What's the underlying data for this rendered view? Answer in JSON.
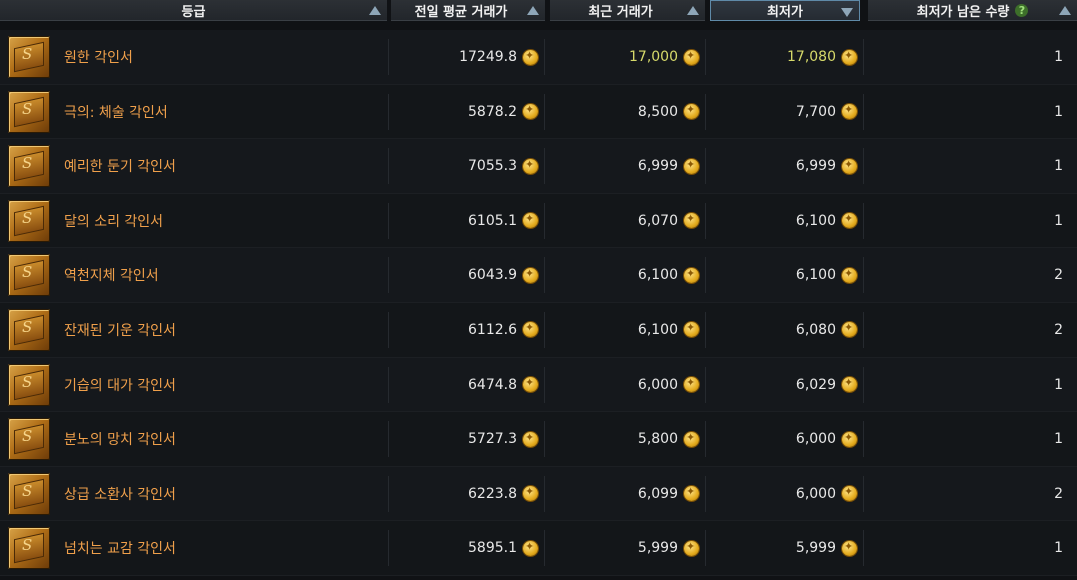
{
  "header": {
    "grade": "등급",
    "prev_avg": "전일 평균 거래가",
    "recent": "최근 거래가",
    "lowest": "최저가",
    "remaining": "최저가 남은 수량",
    "help": "?"
  },
  "rows": [
    {
      "name": "원한 각인서",
      "prev_avg": "17249.8",
      "recent": "17,000",
      "lowest": "17,080",
      "qty": "1",
      "highlight": true
    },
    {
      "name": "극의: 체술 각인서",
      "prev_avg": "5878.2",
      "recent": "8,500",
      "lowest": "7,700",
      "qty": "1"
    },
    {
      "name": "예리한 둔기 각인서",
      "prev_avg": "7055.3",
      "recent": "6,999",
      "lowest": "6,999",
      "qty": "1"
    },
    {
      "name": "달의 소리 각인서",
      "prev_avg": "6105.1",
      "recent": "6,070",
      "lowest": "6,100",
      "qty": "1"
    },
    {
      "name": "역천지체 각인서",
      "prev_avg": "6043.9",
      "recent": "6,100",
      "lowest": "6,100",
      "qty": "2"
    },
    {
      "name": "잔재된 기운 각인서",
      "prev_avg": "6112.6",
      "recent": "6,100",
      "lowest": "6,080",
      "qty": "2"
    },
    {
      "name": "기습의 대가 각인서",
      "prev_avg": "6474.8",
      "recent": "6,000",
      "lowest": "6,029",
      "qty": "1"
    },
    {
      "name": "분노의 망치 각인서",
      "prev_avg": "5727.3",
      "recent": "5,800",
      "lowest": "6,000",
      "qty": "1"
    },
    {
      "name": "상급 소환사 각인서",
      "prev_avg": "6223.8",
      "recent": "6,099",
      "lowest": "6,000",
      "qty": "2"
    },
    {
      "name": "넘치는 교감 각인서",
      "prev_avg": "5895.1",
      "recent": "5,999",
      "lowest": "5,999",
      "qty": "1"
    }
  ],
  "icons": {
    "item": "engraving-book-icon",
    "currency": "gold-coin-icon"
  },
  "colors": {
    "item_name": "#f0a04b",
    "highlight_price": "#d6d96a",
    "header_bg": "#2c3035",
    "sort_arrow": "#8ea6b8"
  }
}
